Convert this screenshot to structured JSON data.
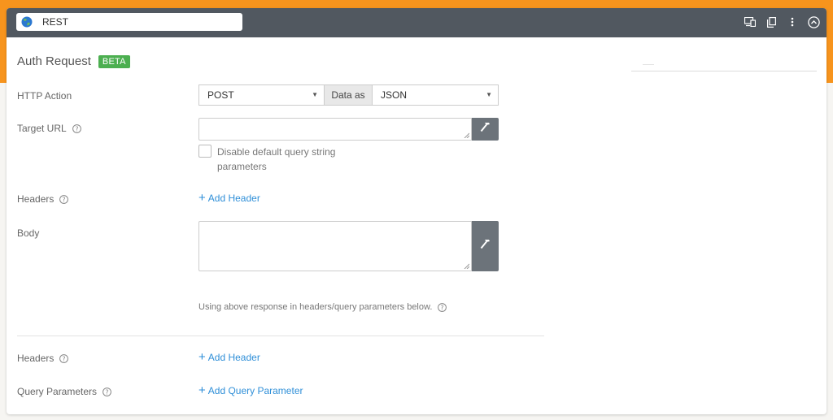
{
  "header": {
    "title": "REST"
  },
  "section": {
    "title": "Auth Request",
    "badge": "BETA"
  },
  "form": {
    "http_action": {
      "label": "HTTP Action",
      "method": "POST",
      "data_as_label": "Data as",
      "data_format": "JSON"
    },
    "target_url": {
      "label": "Target URL",
      "value": "",
      "checkbox_label": "Disable default query string parameters",
      "checked": false
    },
    "headers": {
      "label": "Headers",
      "add_label": "Add Header"
    },
    "body": {
      "label": "Body",
      "value": ""
    },
    "note": "Using above response in headers/query parameters below."
  },
  "response": {
    "headers": {
      "label": "Headers",
      "add_label": "Add Header"
    },
    "query_params": {
      "label": "Query Parameters",
      "add_label": "Add Query Parameter"
    }
  },
  "icons": {
    "top": [
      "devices-icon",
      "copy-icon",
      "more-vertical-icon",
      "collapse-icon"
    ],
    "tool": "hammer-icon",
    "help": "help-circle-icon",
    "globe": "globe-icon"
  },
  "colors": {
    "accent": "#f7941d",
    "topbar": "#515860",
    "link": "#2f8fd8",
    "badge": "#4caf50",
    "tool_button": "#6c737a"
  }
}
